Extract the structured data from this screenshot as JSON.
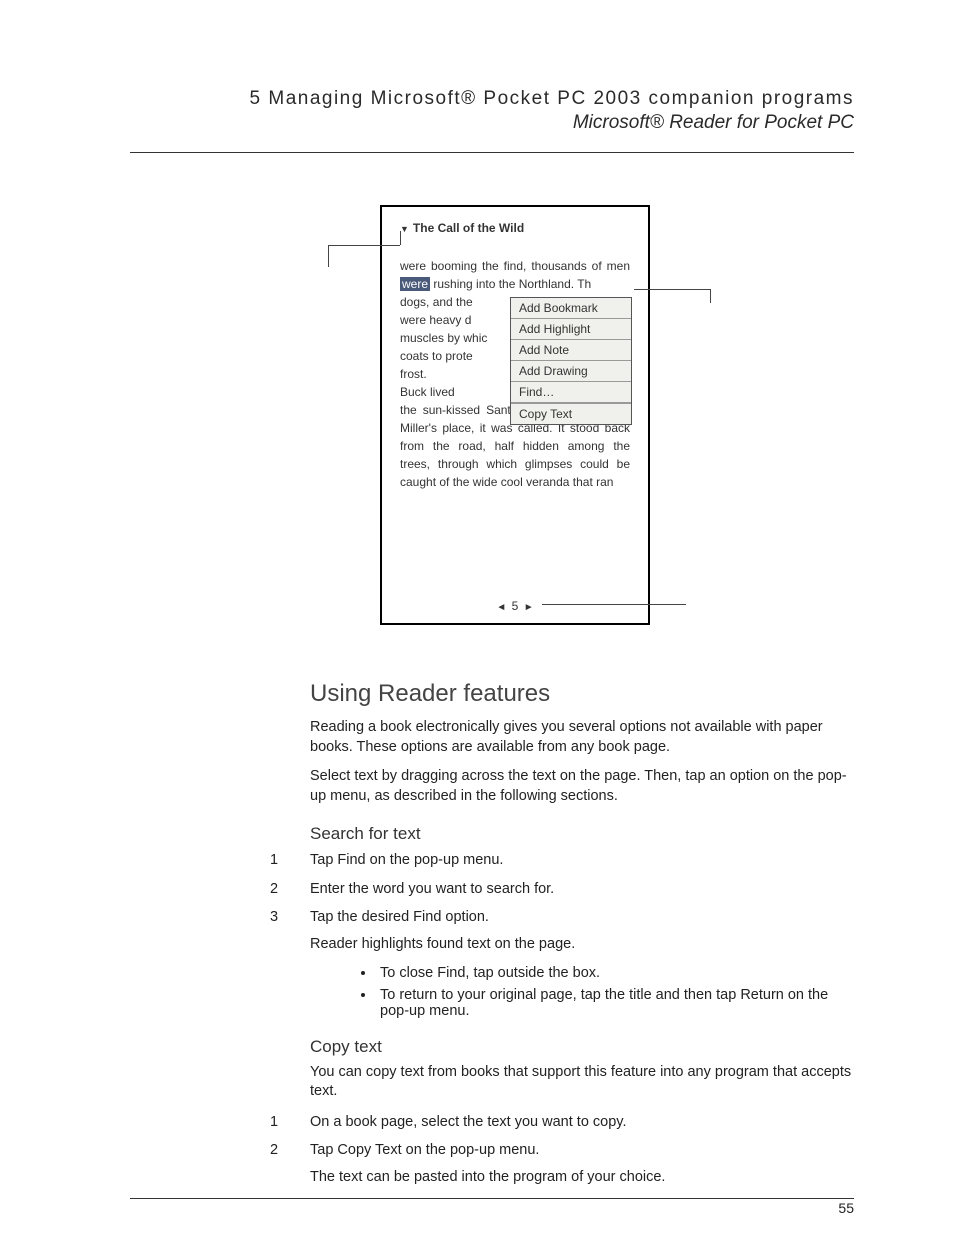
{
  "header": {
    "line1": "5 Managing Microsoft® Pocket PC 2003 companion programs",
    "line2": "Microsoft® Reader for Pocket PC"
  },
  "page_number": "55",
  "shot": {
    "book_title": "The Call of the Wild",
    "text_before_highlight": "were booming the find, thousands of men ",
    "highlighted": "were",
    "text_after_highlight_line": " rushing into the Northland. Th",
    "text_masked_block": "dogs, and the\nwere heavy d\nmuscles by whic\ncoats to prote\nfrost.",
    "text_after_popup": "   Buck lived",
    "text_rest": "the sun-kissed Santa Clara valley. Judge Miller's place, it was called. It stood back from the road, half hidden among the trees, through which glimpses could be caught of the wide cool veranda that ran",
    "popup": {
      "items": [
        "Add Bookmark",
        "Add Highlight",
        "Add Note",
        "Add Drawing",
        "Find…",
        "Copy Text"
      ]
    },
    "pager": {
      "prev": "◄",
      "page": "5",
      "next": "►"
    }
  },
  "sections": {
    "using_reader": {
      "heading": "Using Reader features",
      "p1": "Reading a book electronically gives you several options not available with paper books. These options are available from any book page.",
      "p2": "Select text by dragging across the text on the page. Then, tap an option on the pop-up menu, as described in the following sections."
    },
    "search": {
      "heading": "Search for text",
      "steps": [
        "Tap Find on the pop-up menu.",
        "Enter the word you want to search for.",
        "Tap the desired Find option."
      ],
      "after": "Reader highlights found text on the page.",
      "bullets": [
        "To close Find, tap outside the box.",
        "To return to your original page, tap the title and then tap Return on the pop-up menu."
      ]
    },
    "copy": {
      "heading": "Copy text",
      "intro": "You can copy text from books that support this feature into any program that accepts text.",
      "steps": [
        "On a book page, select the text you want to copy.",
        "Tap Copy Text on the pop-up menu."
      ],
      "after": "The text can be pasted into the program of your choice."
    }
  }
}
